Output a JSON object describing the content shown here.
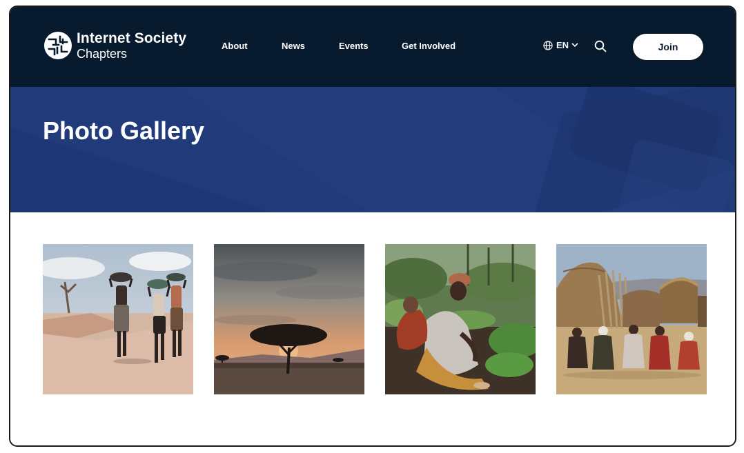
{
  "brand": {
    "name": "Internet Society",
    "subtitle": "Chapters",
    "logo_icon": "isoc-logo-icon"
  },
  "nav": {
    "items": [
      "About",
      "News",
      "Events",
      "Get Involved"
    ]
  },
  "language": {
    "current": "EN",
    "icon": "globe-icon"
  },
  "header": {
    "search_icon": "search-icon",
    "join_label": "Join"
  },
  "hero": {
    "title": "Photo Gallery"
  },
  "gallery": {
    "photos": [
      {
        "subject": "people-carrying-bowls-on-dirt-road"
      },
      {
        "subject": "acacia-tree-at-sunset"
      },
      {
        "subject": "woman-with-baby-tending-crops"
      },
      {
        "subject": "villagers-seated-by-thatched-huts"
      }
    ]
  },
  "colors": {
    "header_bg": "#081a2e",
    "hero_bg": "#213a79",
    "join_bg": "#ffffff",
    "join_text": "#0a1a2e"
  }
}
